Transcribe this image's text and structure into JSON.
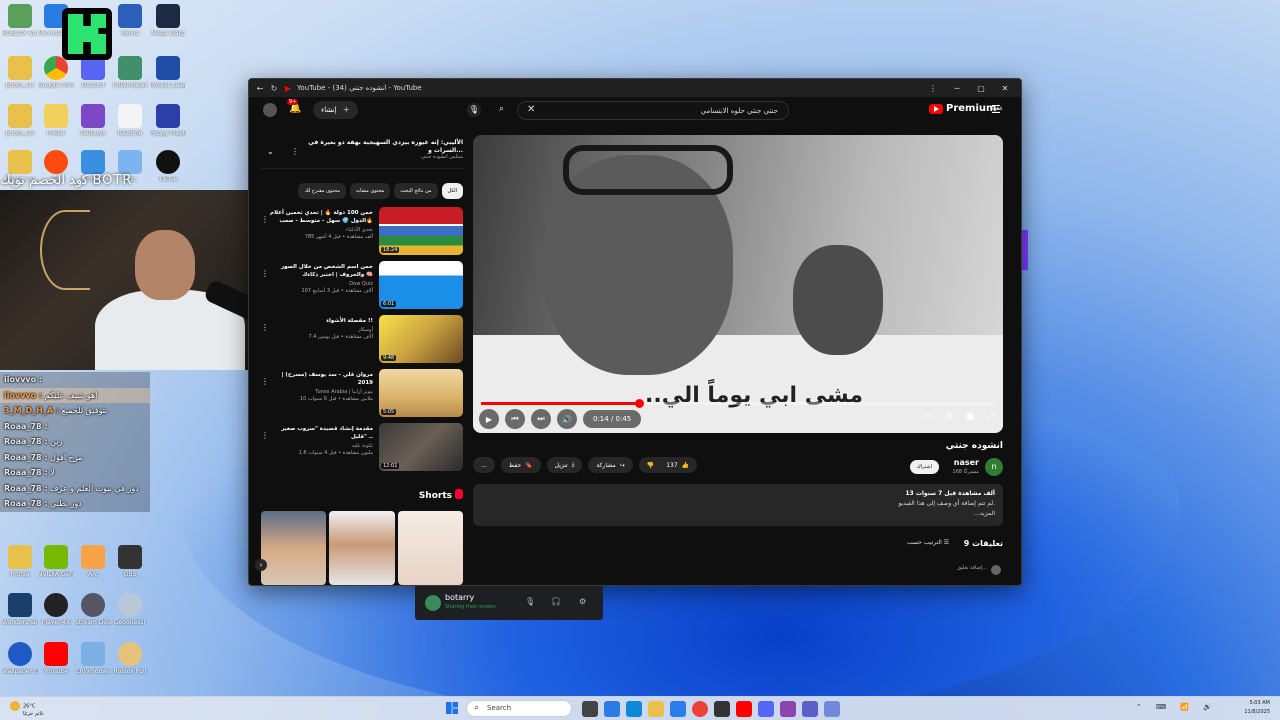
{
  "desktop": {
    "overlay_title": "ﮐوﺪ اﻟﺨﺼﻢ ﺗﻮﻳﻚ BOTR",
    "icons": [
      {
        "label": "ROBLOX Studio"
      },
      {
        "label": "Microsoft Edge"
      },
      {
        "label": "Sylvia"
      },
      {
        "label": "Mega Warp"
      },
      {
        "label": "photo_(1)"
      },
      {
        "label": "Google Chrome"
      },
      {
        "label": "Discord"
      },
      {
        "label": "CRWindows"
      },
      {
        "label": "Rocket League"
      },
      {
        "label": "photo_(2)"
      },
      {
        "label": "Folder"
      },
      {
        "label": "FallGuys"
      },
      {
        "label": "Readme"
      },
      {
        "label": "Poppy Playtime"
      },
      {
        "label": "photo_(3)"
      },
      {
        "label": "EA"
      },
      {
        "label": "Fortnite"
      },
      {
        "label": "Misc"
      },
      {
        "label": "TikTok"
      }
    ],
    "bottom_icons": [
      {
        "label": "Profile"
      },
      {
        "label": "NVIDIA GeForce"
      },
      {
        "label": "Arc"
      },
      {
        "label": "OBS"
      },
      {
        "label": "Wondershare Filmora"
      },
      {
        "label": "Player 4K"
      },
      {
        "label": "Stream Desk"
      },
      {
        "label": "Geoguessr"
      },
      {
        "label": "Wallpaper Engine"
      },
      {
        "label": "YouTube"
      },
      {
        "label": "CRWindows"
      },
      {
        "label": "Roblox Pull"
      }
    ]
  },
  "chat": [
    {
      "user": "iiovvvo :",
      "msg": "",
      "style": "alt"
    },
    {
      "user": "iiovvvo :",
      "msg": "اهو شيف عليكم",
      "style": "hl"
    },
    {
      "user": "3_M_D_H_A :",
      "msg": "بتوفيق للجميع",
      "style": ""
    },
    {
      "user": "Roaa_78 :",
      "msg": "",
      "style": "alt"
    },
    {
      "user": "Roaa_78 :",
      "msg": "زين",
      "style": "alt"
    },
    {
      "user": "Roaa_78 :",
      "msg": "مرح اقول",
      "style": "alt"
    },
    {
      "user": "Roaa_78 :",
      "msg": "لا",
      "style": "alt"
    },
    {
      "user": "Roaa_78 :",
      "msg": "دور في بيوت العلم و عرف",
      "style": "alt"
    },
    {
      "user": "Roaa_78 :",
      "msg": "دور بطني",
      "style": "alt"
    }
  ],
  "window": {
    "title": "YouTube - انشوده جنتي (34) - YouTube",
    "controls": {
      "more": "⋮",
      "min": "─",
      "max": "▢",
      "close": "✕"
    }
  },
  "header": {
    "search_value": "جنتي جنتي حلوه الابتسامي",
    "premium_label": "Premium",
    "premium_badge": "SA",
    "create_label": "إنشاء",
    "notifications_count": "9+"
  },
  "ad": {
    "title": "الأليبي: إنه غيوره بيزدي السهيجية بهفة دو بغيرة في السرات و...",
    "subtitle": "مبتلس انشوده جنتي"
  },
  "chips": [
    {
      "label": "الكل",
      "active": true
    },
    {
      "label": "من نتائج البحث",
      "active": false
    },
    {
      "label": "محتوى مشابه",
      "active": false
    },
    {
      "label": "محتوى مقترح لك",
      "active": false
    }
  ],
  "recs": [
    {
      "title": "خمن 100 دولة 🔥 | تحدي تخمين أعلام الدول 🌍 سهل - متوسط - صعب🔥",
      "channel": "تحدي الأذكياء",
      "views": "785 ألف مشاهدة • قبل 4 أشهر",
      "duration": "18:24"
    },
    {
      "title": "خمن اسم الشخص من خلال الصور والحروف | اختبر ذكاءك 🧠",
      "channel": "Dow Quiz",
      "views": "107 آلاف مشاهدة • قبل 3 أسابيع",
      "duration": "6:01"
    },
    {
      "title": "مقصلة الأشواء !!",
      "channel": "أوسكار",
      "views": "7.4 آلاف مشاهدة • قبل يومين",
      "duration": "9:48"
    },
    {
      "title": "مروان قلي - سد يوسف (مسرح) | 2019",
      "channel": "Tunes Arabia | تيونز أرابيا",
      "views": "10 ملايين مشاهدة • قبل 6 سنوات",
      "duration": "5:05"
    },
    {
      "title": "مقدمة إنشاد قصيدة \"سروب صغير قليل\" ..",
      "channel": "ثكونة عليه",
      "views": "1.8 مليون مشاهدة • قبل 4 سنوات",
      "duration": "12:01"
    }
  ],
  "shorts": {
    "heading": "Shorts"
  },
  "video": {
    "caption": "مشى ابي يوماً الي..",
    "time": "0:14 / 0:45",
    "progress": 0.31,
    "title": "انشوده جنتي",
    "channel": "naser",
    "channel_initial": "n",
    "subscribers": "168 مشتركًا",
    "subscribe_label": "اشتراك",
    "likes": "137",
    "share_label": "مشاركة",
    "download_label": "تنزيل",
    "save_label": "حفظ",
    "more_label": "..."
  },
  "description": {
    "stats": "13 ألف مشاهدة قبل 7 سنوات",
    "line": "لم تتم إضافة أي وصف إلى هذا الفيديو.",
    "more": "...المزيد"
  },
  "comments": {
    "heading": "9 تعليقات",
    "sort_label": "الترتيب حسب",
    "add_placeholder": "إضافة تعليق..."
  },
  "discord": {
    "name": "botarry",
    "status": "Sharing their screen"
  },
  "taskbar": {
    "weather_temp": "26°C",
    "weather_desc": "غائم جزئيًا",
    "search_placeholder": "Search",
    "time": "5:03 AM",
    "date": "11/8/2025",
    "tray_icons": "⌃ ⌨ 📶 🔊"
  },
  "colors": {
    "accent": "#ff0000",
    "brand_bg": "#0f0f0f",
    "discord_status": "#23a55a"
  }
}
